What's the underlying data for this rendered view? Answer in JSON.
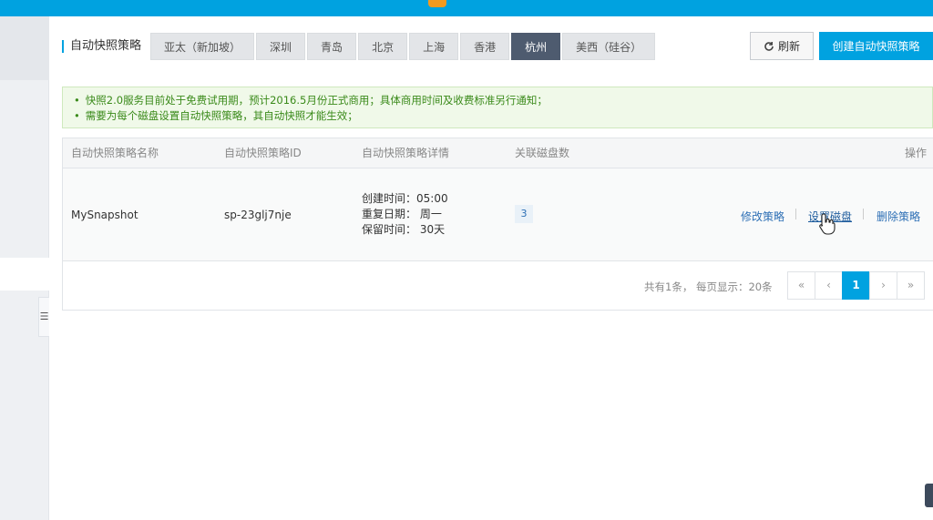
{
  "header": {
    "accent": "#00a2e0"
  },
  "title": "自动快照策略",
  "regions": [
    "亚太（新加坡）",
    "深圳",
    "青岛",
    "北京",
    "上海",
    "香港",
    "杭州",
    "美西（硅谷）"
  ],
  "active_region": "杭州",
  "buttons": {
    "refresh": "刷新",
    "create": "创建自动快照策略"
  },
  "notices": [
    "快照2.0服务目前处于免费试用期，预计2016.5月份正式商用；具体商用时间及收费标准另行通知；",
    "需要为每个磁盘设置自动快照策略，其自动快照才能生效；"
  ],
  "table": {
    "columns": [
      "自动快照策略名称",
      "自动快照策略ID",
      "自动快照策略详情",
      "关联磁盘数",
      "操作"
    ],
    "row": {
      "name": "MySnapshot",
      "id": "sp-23glj7nje",
      "details": [
        "创建时间：05:00",
        "重复日期： 周一",
        "保留时间： 30天"
      ],
      "disk_count": "3",
      "actions": [
        "修改策略",
        "设置磁盘",
        "删除策略"
      ]
    }
  },
  "pagination": {
    "summary": "共有1条， 每页显示：20条",
    "first": "«",
    "prev": "‹",
    "current": "1",
    "next": "›",
    "last": "»"
  }
}
